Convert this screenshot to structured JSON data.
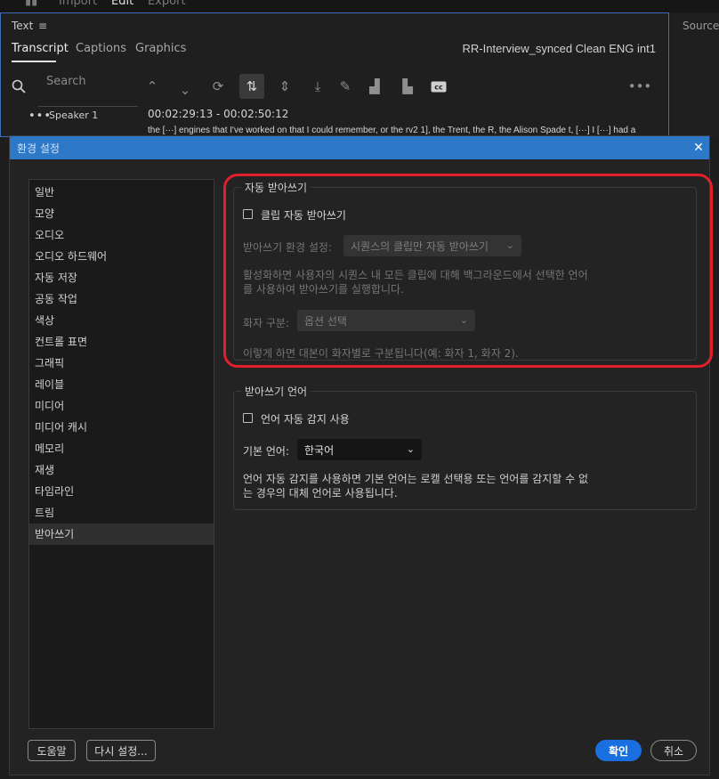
{
  "app": {
    "top_tabs": [
      "Import",
      "Edit",
      "Export"
    ],
    "text_panel": {
      "title": "Text",
      "tabs": [
        "Transcript",
        "Captions",
        "Graphics"
      ],
      "sequence_name": "RR-Interview_synced Clean ENG int1",
      "search_placeholder": "Search",
      "speaker": "Speaker 1",
      "timecode": "00:02:29:13 - 00:02:50:12",
      "transcript_text": "the [···] engines that I've worked on that I could remember, or the rv2 1], the Trent, the R, the Alison Spade t, [···] I [···] had a"
    },
    "source_panel_label": "Source: ("
  },
  "dialog": {
    "title": "환경 설정",
    "categories": [
      "일반",
      "모양",
      "오디오",
      "오디오 하드웨어",
      "자동 저장",
      "공동 작업",
      "색상",
      "컨트롤 표면",
      "그래픽",
      "레이블",
      "미디어",
      "미디어 캐시",
      "메모리",
      "재생",
      "타임라인",
      "트림",
      "받아쓰기"
    ],
    "selected_category": "받아쓰기",
    "auto_transcribe": {
      "legend": "자동 받아쓰기",
      "checkbox_label": "클립 자동 받아쓰기",
      "checked": false,
      "pref_label": "받아쓰기 환경 설정:",
      "pref_value": "시퀀스의 클립만 자동 받아쓰기",
      "pref_desc_line1": "활성화하면 사용자의 시퀀스 내 모든 클립에 대해 백그라운드에서 선택한 언어",
      "pref_desc_line2": "를 사용하여 받아쓰기를 실행합니다.",
      "speaker_label": "화자 구분:",
      "speaker_value": "옵션 선택",
      "speaker_desc": "이렇게 하면 대본이 화자별로 구분됩니다(예: 화자 1, 화자 2)."
    },
    "language": {
      "legend": "받아쓰기 언어",
      "checkbox_label": "언어 자동 감지 사용",
      "checked": false,
      "default_label": "기본 언어:",
      "default_value": "한국어",
      "desc_line1": "언어 자동 감지를 사용하면 기본 언어는 로캘 선택용 또는 언어를 감지할 수 없",
      "desc_line2": "는 경우의 대체 언어로 사용됩니다."
    },
    "buttons": {
      "help": "도움말",
      "reset": "다시 설정...",
      "ok": "확인",
      "cancel": "취소"
    },
    "close_glyph": "✕"
  },
  "colors": {
    "dialog_titlebar": "#2e79c7",
    "highlight_outline": "#e2202c",
    "primary_button": "#1a6fe0"
  }
}
